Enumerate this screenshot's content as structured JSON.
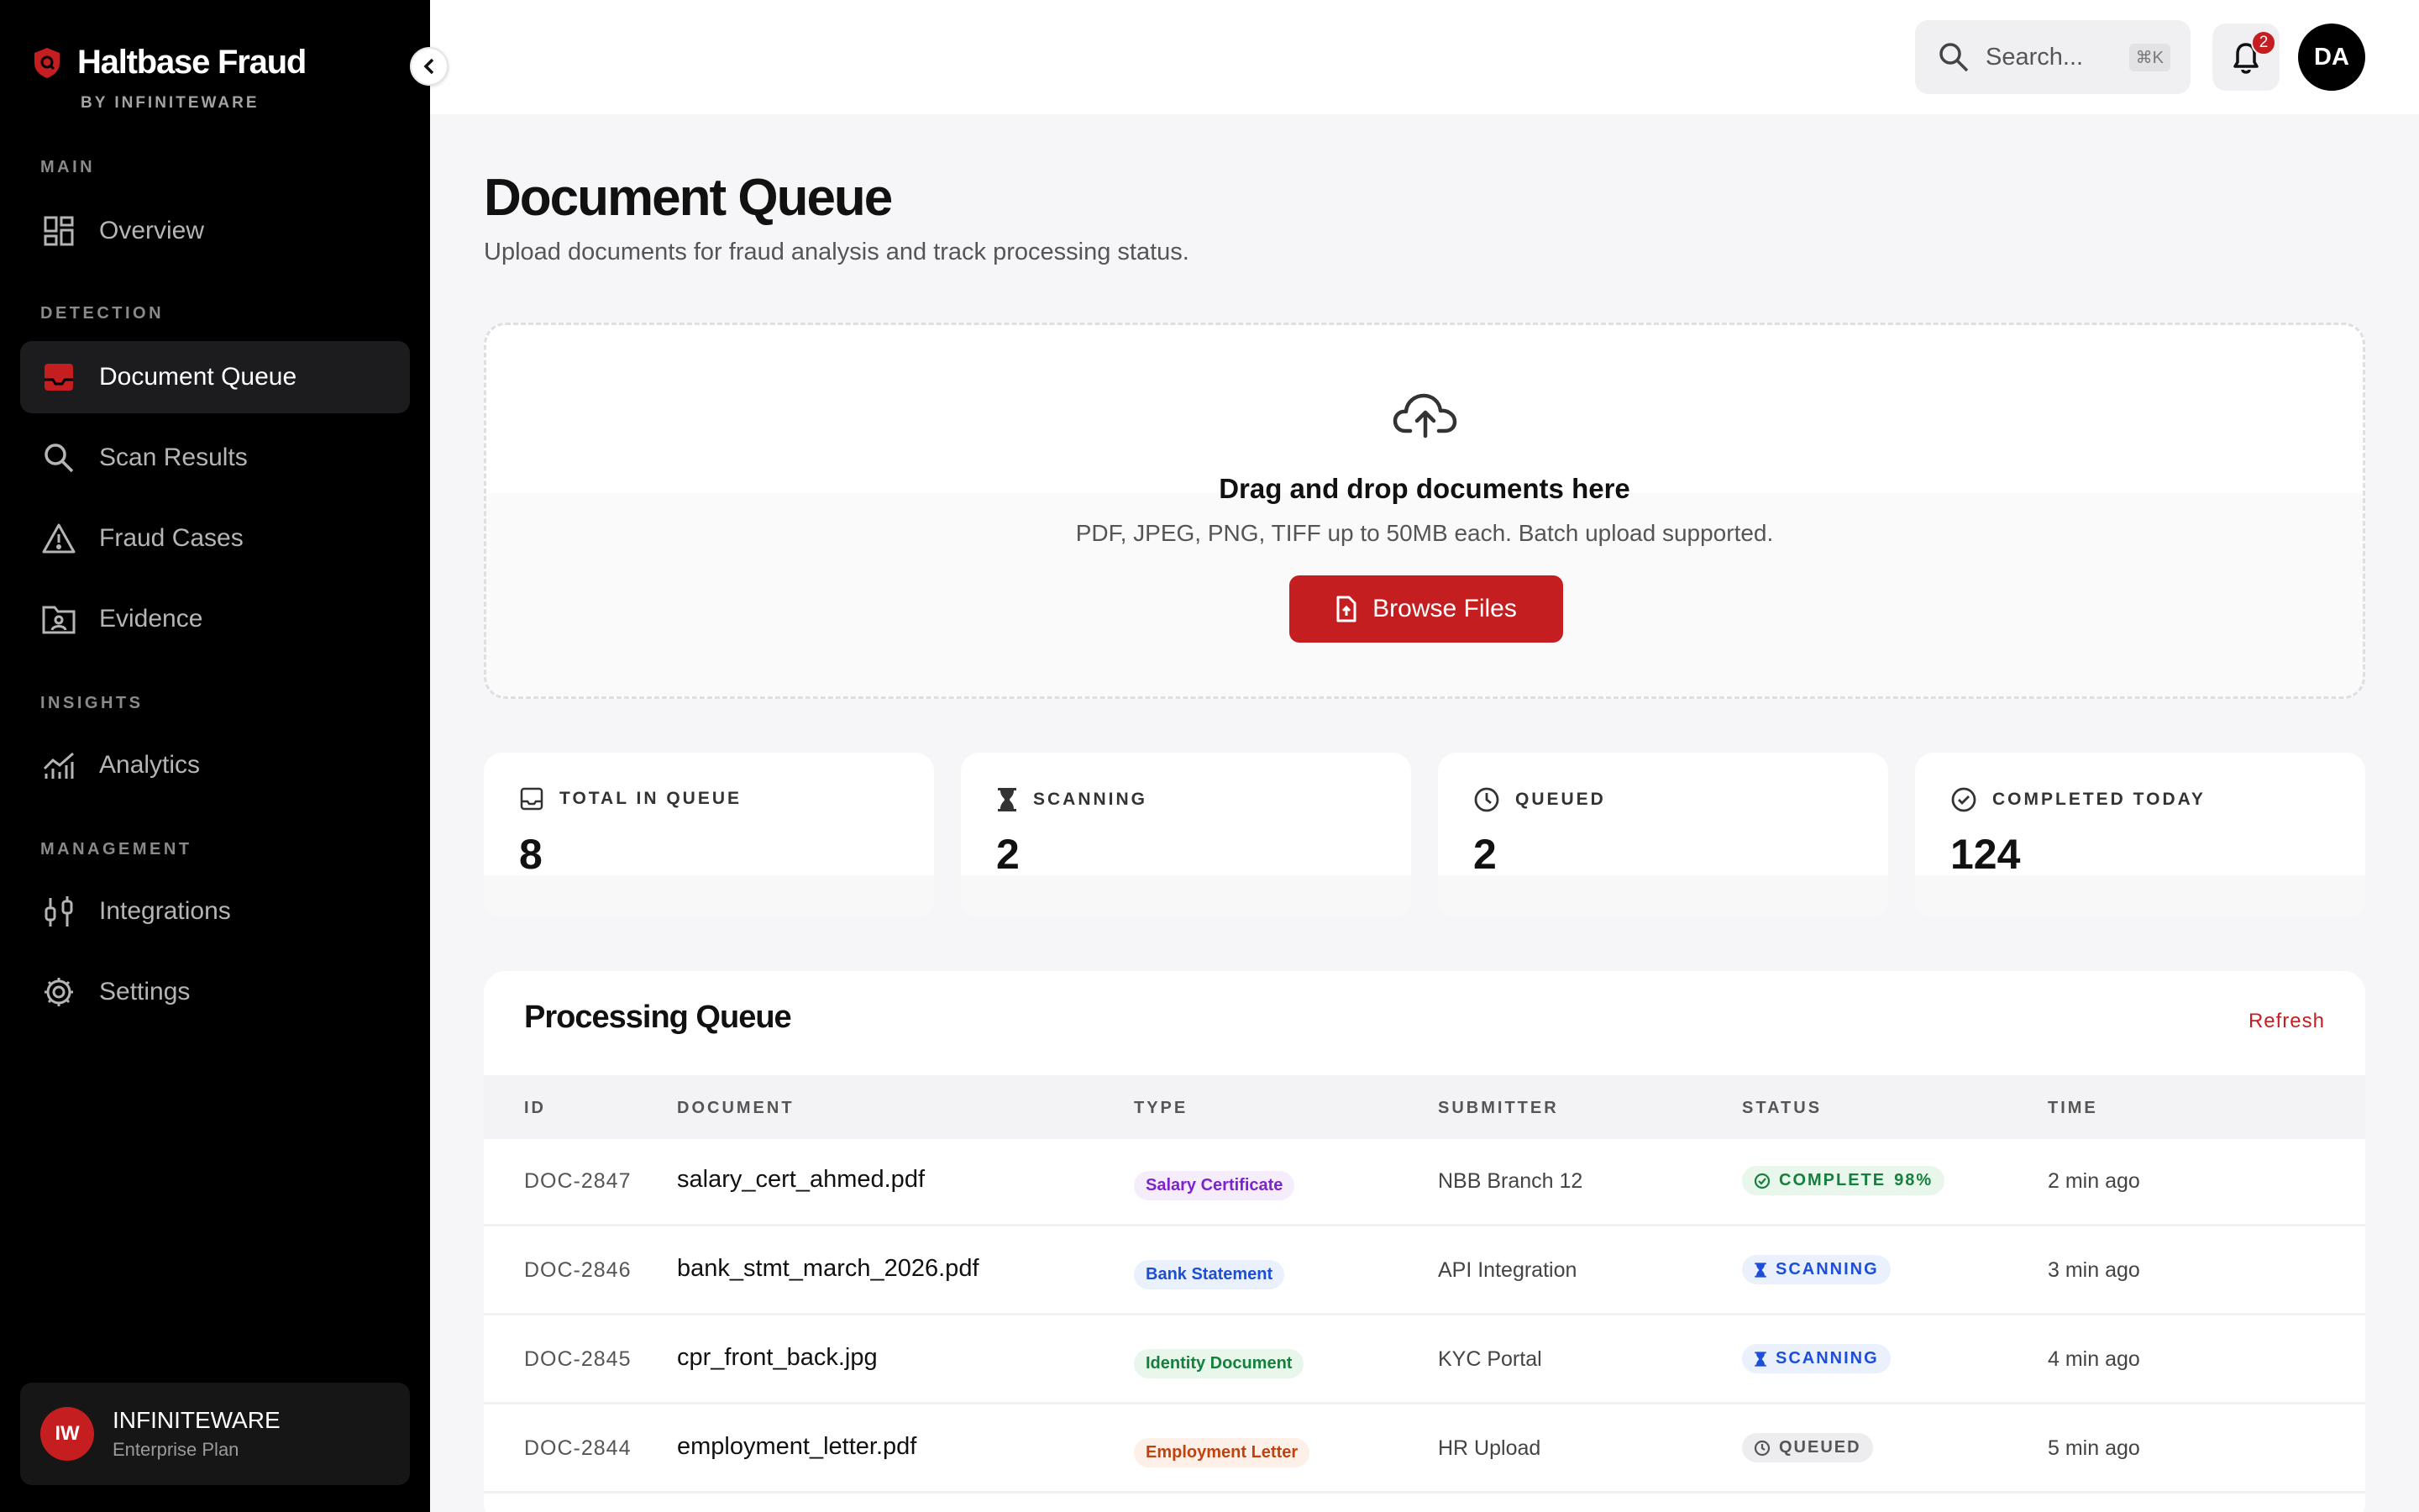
{
  "app": {
    "brand_name": "Haltbase Fraud",
    "brand_sub": "BY INFINITEWARE"
  },
  "sidebar": {
    "sections": [
      {
        "label": "MAIN"
      },
      {
        "label": "DETECTION"
      },
      {
        "label": "INSIGHTS"
      },
      {
        "label": "MANAGEMENT"
      }
    ],
    "items": [
      {
        "label": "Overview",
        "icon": "grid-icon"
      },
      {
        "label": "Document Queue",
        "icon": "inbox-icon",
        "active": true
      },
      {
        "label": "Scan Results",
        "icon": "search-icon"
      },
      {
        "label": "Fraud Cases",
        "icon": "warning-icon"
      },
      {
        "label": "Evidence",
        "icon": "folder-user-icon"
      },
      {
        "label": "Analytics",
        "icon": "chart-icon"
      },
      {
        "label": "Integrations",
        "icon": "plug-icon"
      },
      {
        "label": "Settings",
        "icon": "gear-icon"
      }
    ],
    "org": {
      "initials": "IW",
      "name": "INFINITEWARE",
      "plan": "Enterprise Plan"
    }
  },
  "topbar": {
    "search_placeholder": "Search...",
    "search_shortcut": "⌘K",
    "notification_count": "2",
    "user_initials": "DA"
  },
  "page": {
    "title": "Document Queue",
    "subtitle": "Upload documents for fraud analysis and track processing status."
  },
  "dropzone": {
    "title": "Drag and drop documents here",
    "subtitle": "PDF, JPEG, PNG, TIFF up to 50MB each. Batch upload supported.",
    "button_label": "Browse Files"
  },
  "stats": [
    {
      "label": "TOTAL IN QUEUE",
      "value": "8",
      "icon": "inbox-icon"
    },
    {
      "label": "SCANNING",
      "value": "2",
      "icon": "hourglass-icon"
    },
    {
      "label": "QUEUED",
      "value": "2",
      "icon": "clock-icon"
    },
    {
      "label": "COMPLETED TODAY",
      "value": "124",
      "icon": "check-circle-icon"
    }
  ],
  "queue": {
    "title": "Processing Queue",
    "refresh_label": "Refresh",
    "columns": [
      "ID",
      "DOCUMENT",
      "TYPE",
      "SUBMITTER",
      "STATUS",
      "TIME"
    ],
    "rows": [
      {
        "id": "DOC-2847",
        "document": "salary_cert_ahmed.pdf",
        "type": "Salary Certificate",
        "submitter": "NBB Branch 12",
        "status": "COMPLETE",
        "percent": "98%",
        "time": "2 min ago"
      },
      {
        "id": "DOC-2846",
        "document": "bank_stmt_march_2026.pdf",
        "type": "Bank Statement",
        "submitter": "API Integration",
        "status": "SCANNING",
        "time": "3 min ago"
      },
      {
        "id": "DOC-2845",
        "document": "cpr_front_back.jpg",
        "type": "Identity Document",
        "submitter": "KYC Portal",
        "status": "SCANNING",
        "time": "4 min ago"
      },
      {
        "id": "DOC-2844",
        "document": "employment_letter.pdf",
        "type": "Employment Letter",
        "submitter": "HR Upload",
        "status": "QUEUED",
        "time": "5 min ago"
      }
    ]
  },
  "colors": {
    "accent": "#c41e20",
    "sidebar_bg": "#000000",
    "salary_badge": "#7e22ce",
    "bank_badge": "#1d4ed8",
    "identity_badge": "#15803d",
    "employment_badge": "#c2410c",
    "complete": "#15803d",
    "scanning": "#1d4ed8",
    "queued": "#555555"
  }
}
